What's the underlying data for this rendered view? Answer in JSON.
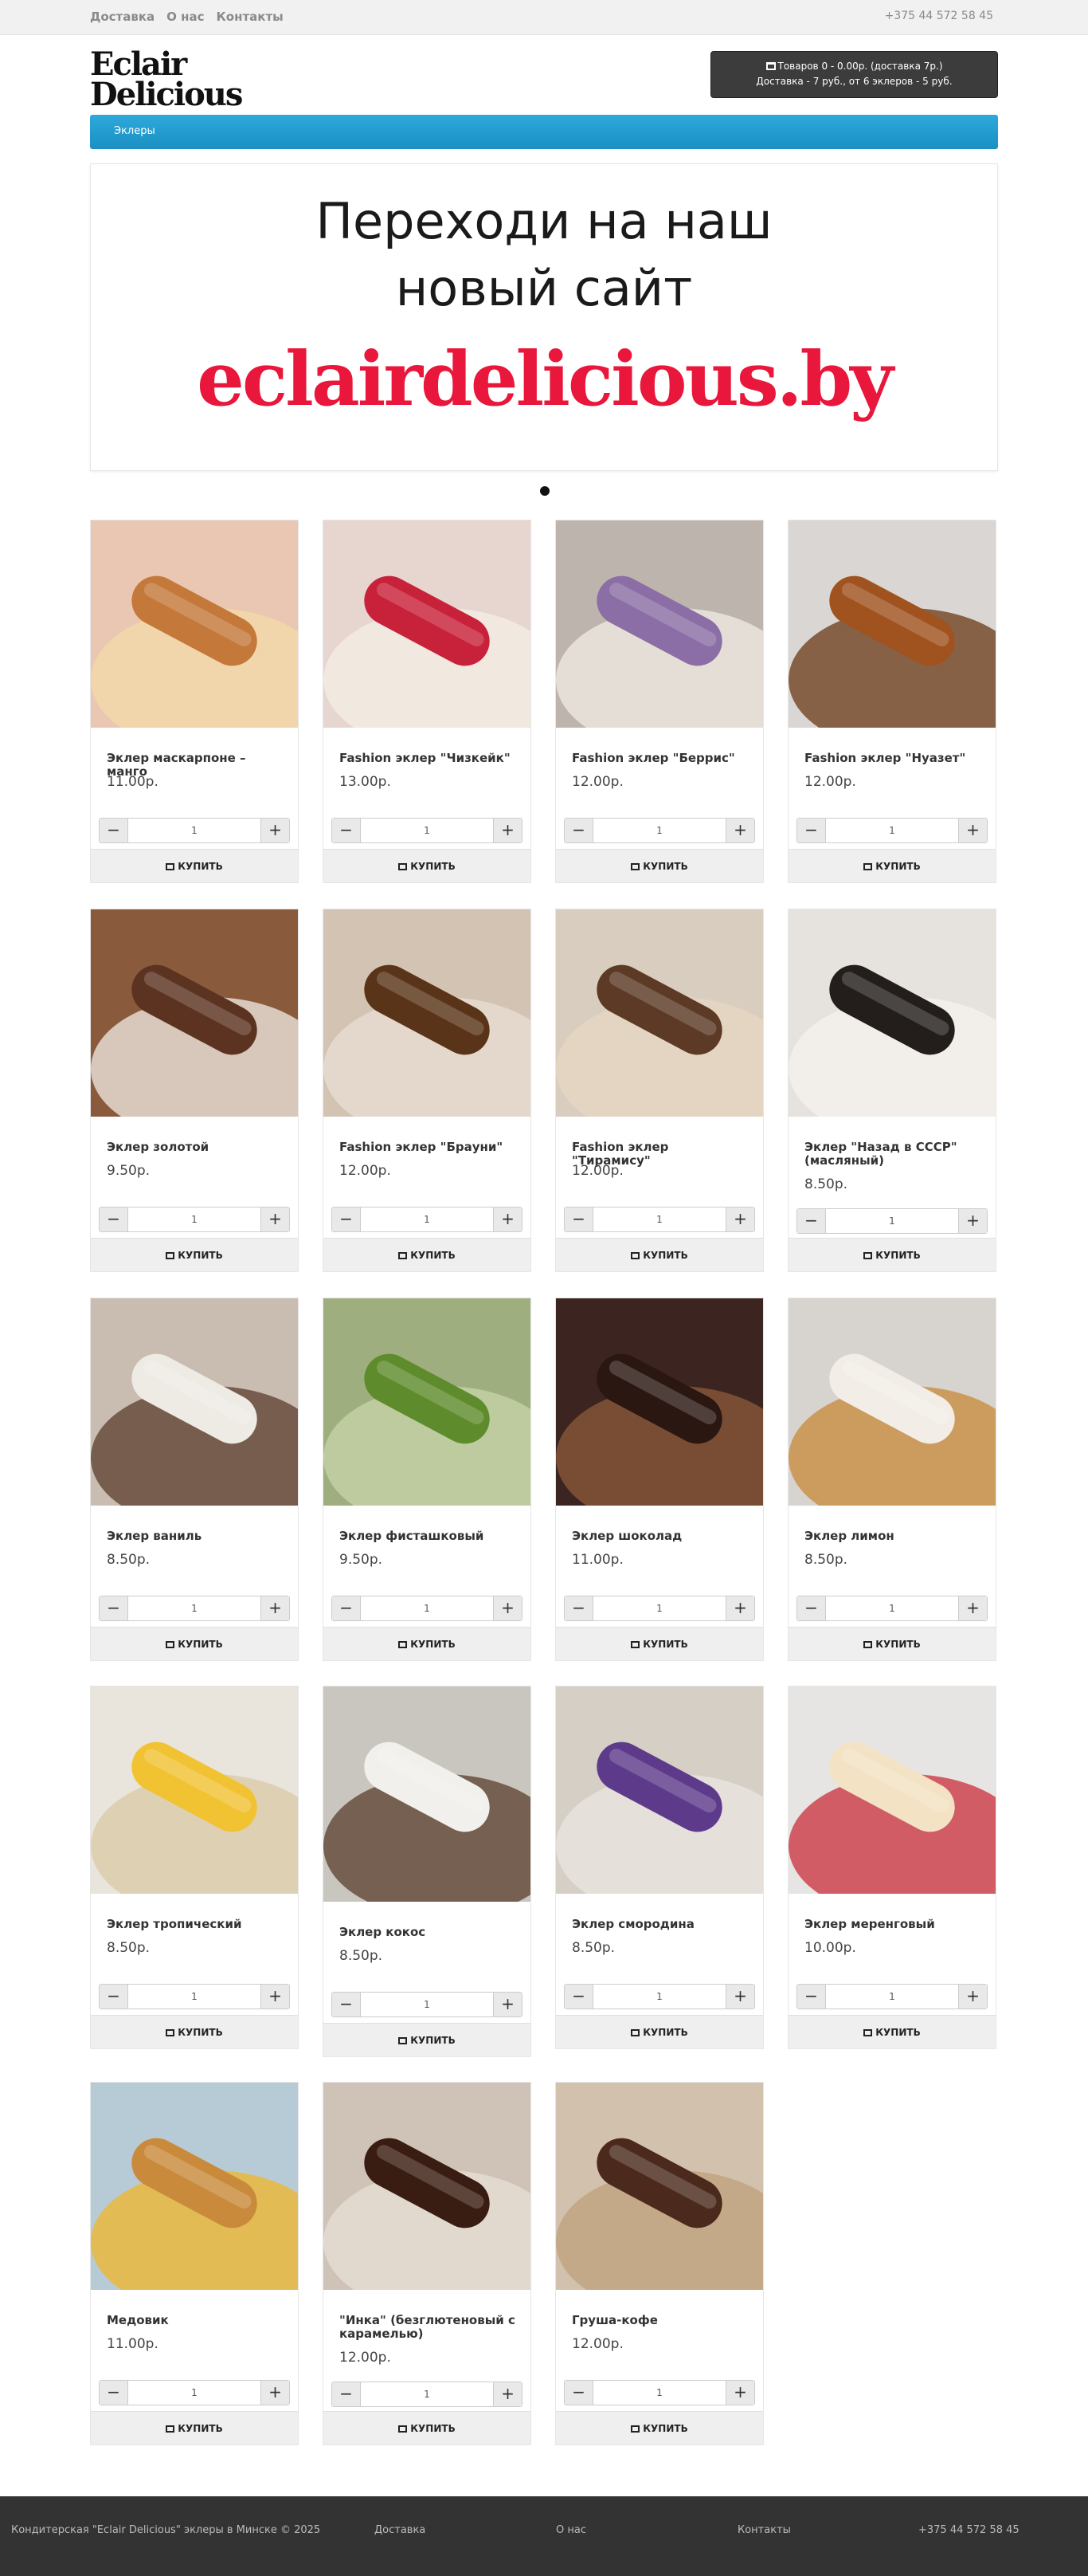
{
  "topbar": {
    "links": [
      "Доставка",
      "О нас",
      "Контакты"
    ],
    "phone": "+375 44 572 58 45"
  },
  "header": {
    "logo_line1": "Eclair",
    "logo_line2": "Delicious",
    "cart_line1": "Товаров 0 - 0.00р. (доставка 7р.)",
    "cart_line2": "Доставка - 7 руб., от 6 эклеров - 5 руб."
  },
  "menu": {
    "item": "Эклеры"
  },
  "banner": {
    "line1": "Переходи на наш",
    "line2": "новый сайт",
    "url_text": "eclairdelicious.by"
  },
  "buy_label": "КУПИТЬ",
  "default_qty": "1",
  "products": [
    {
      "name": "Эклер маскарпоне – манго",
      "price": "11.00р.",
      "colors": [
        "#e9c7b2",
        "#c4783a",
        "#f3d9a8"
      ]
    },
    {
      "name": "Fashion эклер \"Чизкейк\"",
      "price": "13.00р.",
      "colors": [
        "#e6d6cf",
        "#c8213a",
        "#f4ede6"
      ]
    },
    {
      "name": "Fashion эклер \"Беррис\"",
      "price": "12.00р.",
      "colors": [
        "#bdb5ad",
        "#8b6ea5",
        "#f2ece4"
      ]
    },
    {
      "name": "Fashion эклер \"Нуазет\"",
      "price": "12.00р.",
      "colors": [
        "#d9d6d3",
        "#a0521f",
        "#6b3a16"
      ]
    },
    {
      "name": "Эклер золотой",
      "price": "9.50р.",
      "colors": [
        "#8a5a3c",
        "#5c3320",
        "#f2ece6"
      ]
    },
    {
      "name": "Fashion эклер \"Брауни\"",
      "price": "12.00р.",
      "colors": [
        "#d2c3b2",
        "#5a3418",
        "#e8dfd3"
      ]
    },
    {
      "name": "Fashion эклер \"Тирамису\"",
      "price": "12.00р.",
      "colors": [
        "#d8cdbf",
        "#5c3a25",
        "#e7d7c3"
      ]
    },
    {
      "name": "Эклер \"Назад в СССР\" (масляный)",
      "price": "8.50р.",
      "colors": [
        "#e6e3df",
        "#231e1c",
        "#f5f3ef"
      ]
    },
    {
      "name": "Эклер ваниль",
      "price": "8.50р.",
      "colors": [
        "#c9bdb2",
        "#eeeae4",
        "#5a3e2c"
      ]
    },
    {
      "name": "Эклер фисташковый",
      "price": "9.50р.",
      "colors": [
        "#9fae7f",
        "#5e8b2c",
        "#c8d4a9"
      ]
    },
    {
      "name": "Эклер шоколад",
      "price": "11.00р.",
      "colors": [
        "#3c2520",
        "#2a1712",
        "#8c5b3b"
      ]
    },
    {
      "name": "Эклер лимон",
      "price": "8.50р.",
      "colors": [
        "#d7d3cf",
        "#f2ede6",
        "#c88a3a"
      ]
    },
    {
      "name": "Эклер тропический",
      "price": "8.50р.",
      "colors": [
        "#e9e4dc",
        "#f1c232",
        "#d9c9a5"
      ]
    },
    {
      "name": "Эклер кокос",
      "price": "8.50р.",
      "colors": [
        "#c9c5bf",
        "#f2f0ec",
        "#5a3e2c"
      ]
    },
    {
      "name": "Эклер смородина",
      "price": "8.50р.",
      "colors": [
        "#d5cfc6",
        "#5d3b8a",
        "#e9e6e0"
      ]
    },
    {
      "name": "Эклер меренговый",
      "price": "10.00р.",
      "colors": [
        "#e7e5e3",
        "#f3e2c4",
        "#c92d3c"
      ]
    },
    {
      "name": "Медовик",
      "price": "11.00р.",
      "colors": [
        "#b7cbd6",
        "#c98a3c",
        "#f1b62a"
      ]
    },
    {
      "name": "\"Инка\" (безглютеновый с карамелью)",
      "price": "12.00р.",
      "colors": [
        "#cfc2b7",
        "#3a1d12",
        "#e8e0d6"
      ]
    },
    {
      "name": "Груша-кофе",
      "price": "12.00р.",
      "colors": [
        "#d2c2ad",
        "#4b2a1d",
        "#bfa07e"
      ]
    }
  ],
  "footer": {
    "copyright": "Кондитерская \"Eclair Delicious\" эклеры в Минске © 2025",
    "links": [
      "Доставка",
      "О нас",
      "Контакты"
    ],
    "phone": "+375 44 572 58 45"
  }
}
